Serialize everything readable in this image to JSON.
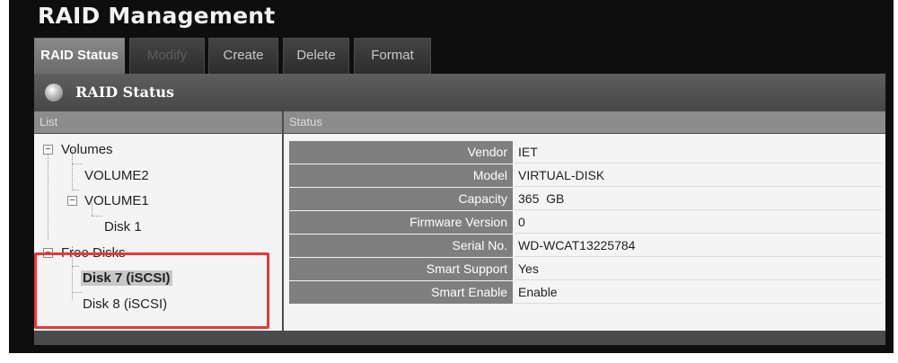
{
  "app": {
    "title": "RAID Management"
  },
  "tabs": [
    {
      "label": "RAID Status",
      "active": true
    },
    {
      "label": "Modify",
      "disabled": true
    },
    {
      "label": "Create"
    },
    {
      "label": "Delete"
    },
    {
      "label": "Format"
    }
  ],
  "panel": {
    "title": "RAID Status",
    "icon": "status-icon"
  },
  "columns": {
    "list": "List",
    "status": "Status"
  },
  "tree": {
    "volumes": "Volumes",
    "volume2": "VOLUME2",
    "volume1": "VOLUME1",
    "disk1": "Disk 1",
    "free_disks": "Free Disks",
    "disk7": "Disk 7 (iSCSI)",
    "disk8": "Disk 8 (iSCSI)",
    "toggle_symbol": "−"
  },
  "status": {
    "vendor_key": "Vendor",
    "vendor_val": "IET",
    "model_key": "Model",
    "model_val": "VIRTUAL-DISK",
    "capacity_key": "Capacity",
    "capacity_val": "365  GB",
    "firmware_key": "Firmware Version",
    "firmware_val": "0",
    "serial_key": "Serial No.",
    "serial_val": "WD-WCAT13225784",
    "smart_support_key": "Smart Support",
    "smart_support_val": "Yes",
    "smart_enable_key": "Smart Enable",
    "smart_enable_val": "Enable"
  },
  "colors": {
    "highlight": "#e33b3b",
    "active_tab": "#7a7a7a"
  }
}
